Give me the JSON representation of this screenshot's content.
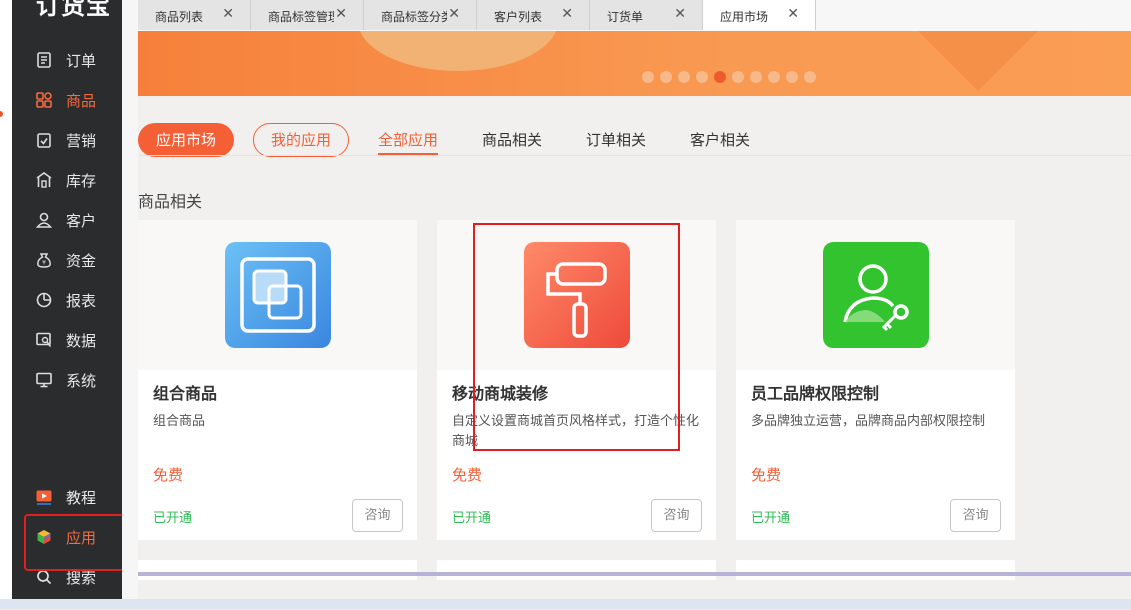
{
  "app": {
    "logo": "订货宝"
  },
  "sidebar": {
    "items": [
      {
        "label": "订单",
        "icon": "order-icon"
      },
      {
        "label": "商品",
        "icon": "goods-icon",
        "active": true
      },
      {
        "label": "营销",
        "icon": "marketing-icon"
      },
      {
        "label": "库存",
        "icon": "warehouse-icon"
      },
      {
        "label": "客户",
        "icon": "user-icon"
      },
      {
        "label": "资金",
        "icon": "money-bag-icon"
      },
      {
        "label": "报表",
        "icon": "pie-chart-icon"
      },
      {
        "label": "数据",
        "icon": "data-icon"
      },
      {
        "label": "系统",
        "icon": "monitor-icon"
      },
      {
        "label": "教程",
        "icon": "video-icon"
      },
      {
        "label": "应用",
        "icon": "cube-icon",
        "active": true
      },
      {
        "label": "搜索",
        "icon": "search-icon"
      }
    ]
  },
  "tabs": [
    {
      "label": "商品列表"
    },
    {
      "label": "商品标签管理"
    },
    {
      "label": "商品标签分类"
    },
    {
      "label": "客户列表"
    },
    {
      "label": "订货单"
    },
    {
      "label": "应用市场",
      "active": true
    }
  ],
  "banner": {
    "dots": 10,
    "active_dot": 4
  },
  "filters": {
    "app_market": "应用市场",
    "my_apps": "我的应用",
    "categories": [
      "全部应用",
      "商品相关",
      "订单相关",
      "客户相关"
    ]
  },
  "section": {
    "title": "商品相关"
  },
  "cards": [
    {
      "name": "组合商品",
      "desc": "组合商品",
      "price": "免费",
      "status": "已开通",
      "consult": "咨询",
      "icon": "combine-goods-icon"
    },
    {
      "name": "移动商城装修",
      "desc": "自定义设置商城首页风格样式，打造个性化商城",
      "price": "免费",
      "status": "已开通",
      "consult": "咨询",
      "icon": "paint-roller-icon"
    },
    {
      "name": "员工品牌权限控制",
      "desc": "多品牌独立运营，品牌商品内部权限控制",
      "price": "免费",
      "status": "已开通",
      "consult": "咨询",
      "icon": "user-key-icon"
    }
  ],
  "colors": {
    "accent": "#f55f35",
    "sidebar_bg": "#2b2c2e",
    "success": "#2fbe55",
    "annotation": "#e02020"
  }
}
